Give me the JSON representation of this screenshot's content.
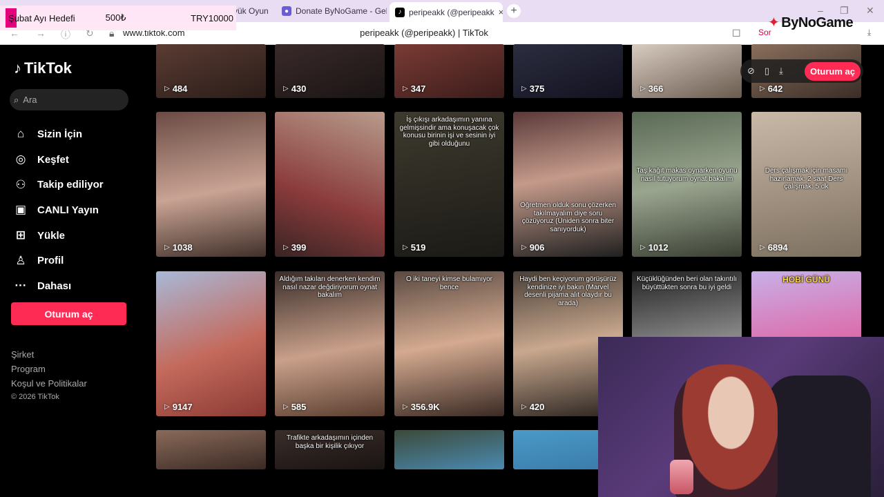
{
  "browser": {
    "tabs": [
      {
        "label": "yük Oyun",
        "fav_color": "#d9534f",
        "active": false
      },
      {
        "label": "Donate ByNoGame - Geler",
        "fav_color": "#6b5bd6",
        "active": false
      },
      {
        "label": "peripeakk (@peripeakk",
        "fav_color": "#000000",
        "active": true
      }
    ],
    "url": "www.tiktok.com",
    "page_title": "peripeakk (@peripeakk) | TikTok",
    "sor_label": "Sor"
  },
  "overlay": {
    "goal_label": "Şubat Ayı Hedefi",
    "goal_current": "500₺",
    "goal_target": "TRY10000",
    "brand": "ByNoGame"
  },
  "sidebar": {
    "logo": "TikTok",
    "search_placeholder": "Ara",
    "items": [
      {
        "label": "Sizin İçin",
        "icon": "home-icon"
      },
      {
        "label": "Keşfet",
        "icon": "compass-icon"
      },
      {
        "label": "Takip ediliyor",
        "icon": "following-icon"
      },
      {
        "label": "CANLI Yayın",
        "icon": "live-icon"
      },
      {
        "label": "Yükle",
        "icon": "upload-icon"
      },
      {
        "label": "Profil",
        "icon": "profile-icon"
      },
      {
        "label": "Dahası",
        "icon": "more-icon"
      }
    ],
    "login_button": "Oturum aç",
    "footer": [
      "Şirket",
      "Program",
      "Koşul ve Politikalar"
    ],
    "copyright": "© 2026 TikTok"
  },
  "pill": {
    "login_label": "Oturum aç"
  },
  "videos": [
    {
      "views": "484",
      "caption": ""
    },
    {
      "views": "430",
      "caption": ""
    },
    {
      "views": "347",
      "caption": ""
    },
    {
      "views": "375",
      "caption": ""
    },
    {
      "views": "366",
      "caption": ""
    },
    {
      "views": "642",
      "caption": ""
    },
    {
      "views": "1038",
      "caption": ""
    },
    {
      "views": "399",
      "caption": ""
    },
    {
      "views": "519",
      "caption": "İş çıkışı arkadaşımın yanına gelmişsindir ama konuşacak çok konusu birinin işi ve sesinin iyi gibi olduğunu"
    },
    {
      "views": "906",
      "caption": "Öğretmen olduk sonu çözerken takılmayalım diye soru çözüyoruz (Üniden sonra biter sanıyorduk)"
    },
    {
      "views": "1012",
      "caption": "Taş kağıt makas oynarken oyunu nasıl tutuyorum oynat bakalım"
    },
    {
      "views": "6894",
      "caption": "Ders çalışmak için masamı hazırlamak: 2 saat Ders çalışmak: 5 dk"
    },
    {
      "views": "9147",
      "caption": ""
    },
    {
      "views": "585",
      "caption": "Aldığım takıları denerken kendim nasıl nazar değdiriyorum oynat bakalım"
    },
    {
      "views": "356.9K",
      "caption": "O iki taneyi kimse bulamıyor bence"
    },
    {
      "views": "420",
      "caption": "Haydi ben keçiyorum görüşürüz kendinize iyi bakın (Marvel desenli pijama alıt olaydır bu arada)"
    },
    {
      "views": "",
      "caption": "Küçüklüğünden beri olan takıntılı büyüttükten sonra bu iyi geldi"
    },
    {
      "views": "",
      "caption": "HOBİ GÜNÜ"
    },
    {
      "views": "",
      "caption": ""
    },
    {
      "views": "",
      "caption": "Trafikte arkadaşımın içinden başka bir kişilik çıkıyor"
    },
    {
      "views": "",
      "caption": ""
    },
    {
      "views": "",
      "caption": ""
    }
  ],
  "colors": {
    "accent": "#fe2c55",
    "overlay_pink": "#e6007e"
  }
}
